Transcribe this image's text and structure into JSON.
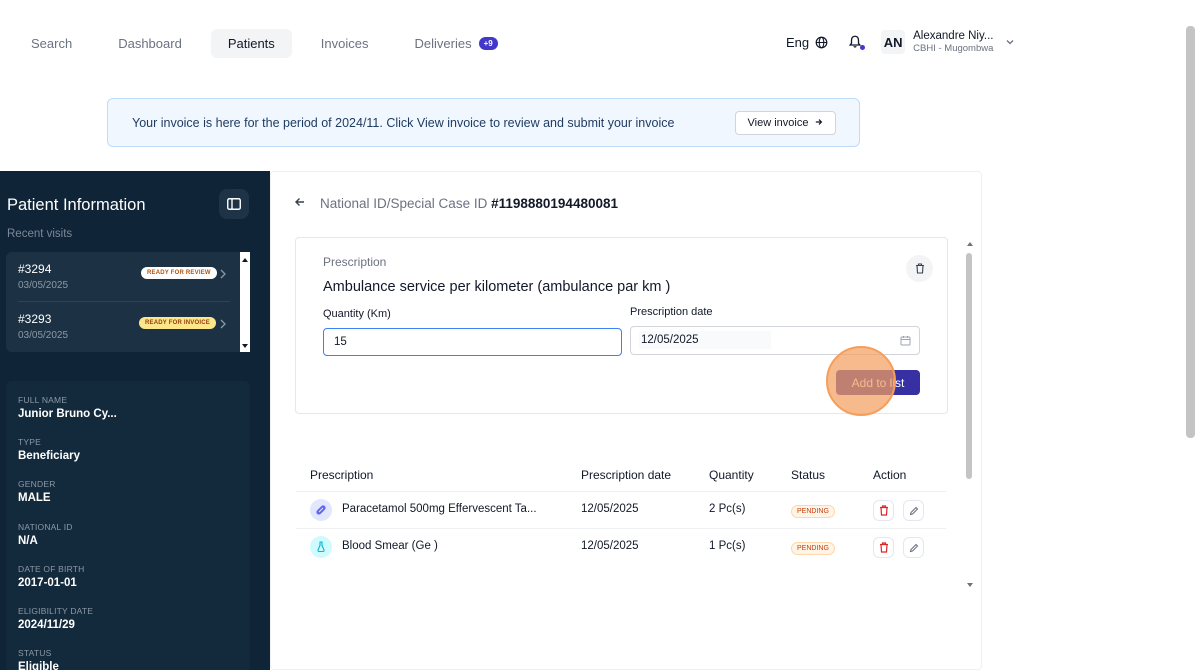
{
  "nav": {
    "items": [
      {
        "label": "Search"
      },
      {
        "label": "Dashboard"
      },
      {
        "label": "Patients"
      },
      {
        "label": "Invoices"
      },
      {
        "label": "Deliveries",
        "badge": "+9"
      }
    ],
    "active": "Patients"
  },
  "header": {
    "language": "Eng",
    "user_initials": "AN",
    "user_name": "Alexandre Niy...",
    "user_org": "CBHI - Mugombwa"
  },
  "banner": {
    "text": "Your invoice is here for the period of 2024/11. Click View invoice to review and submit your invoice",
    "button": "View invoice"
  },
  "sidebar": {
    "title": "Patient Information",
    "subtitle": "Recent visits",
    "visits": [
      {
        "id": "#3294",
        "date": "03/05/2025",
        "status": "READY FOR REVIEW",
        "status_color": "#ffffff",
        "status_text_color": "#b45309"
      },
      {
        "id": "#3293",
        "date": "03/05/2025",
        "status": "READY FOR INVOICE",
        "status_color": "#fde68a",
        "status_text_color": "#92400e"
      }
    ],
    "details": [
      {
        "label": "FULL NAME",
        "value": "Junior Bruno Cy..."
      },
      {
        "label": "TYPE",
        "value": "Beneficiary"
      },
      {
        "label": "GENDER",
        "value": "MALE"
      },
      {
        "label": "NATIONAL ID",
        "value": "N/A"
      },
      {
        "label": "DATE OF BIRTH",
        "value": "2017-01-01"
      },
      {
        "label": "ELIGIBILITY DATE",
        "value": "2024/11/29"
      },
      {
        "label": "STATUS",
        "value": "Eligible"
      }
    ]
  },
  "main": {
    "case_label": "National ID/Special Case ID",
    "case_id": "#1198880194480081",
    "form": {
      "section_label": "Prescription",
      "service_name": "Ambulance service per kilometer (ambulance par km )",
      "quantity_label": "Quantity (Km)",
      "quantity_value": "15",
      "date_label": "Prescription date",
      "date_value": "12/05/2025",
      "add_button": "Add to list"
    },
    "table": {
      "headers": [
        "Prescription",
        "Prescription date",
        "Quantity",
        "Status",
        "Action"
      ],
      "rows": [
        {
          "name": "Paracetamol 500mg Effervescent Ta...",
          "date": "12/05/2025",
          "quantity": "2 Pc(s)",
          "status": "PENDING",
          "icon": "pill-icon",
          "icon_bg": "#e0e7ff"
        },
        {
          "name": "Blood Smear (Ge )",
          "date": "12/05/2025",
          "quantity": "1 Pc(s)",
          "status": "PENDING",
          "icon": "flask-icon",
          "icon_bg": "#cffafe"
        }
      ]
    }
  },
  "colors": {
    "sidebar_bg": "#0f2436",
    "accent": "#3730a3",
    "pending": "#c2410c"
  }
}
